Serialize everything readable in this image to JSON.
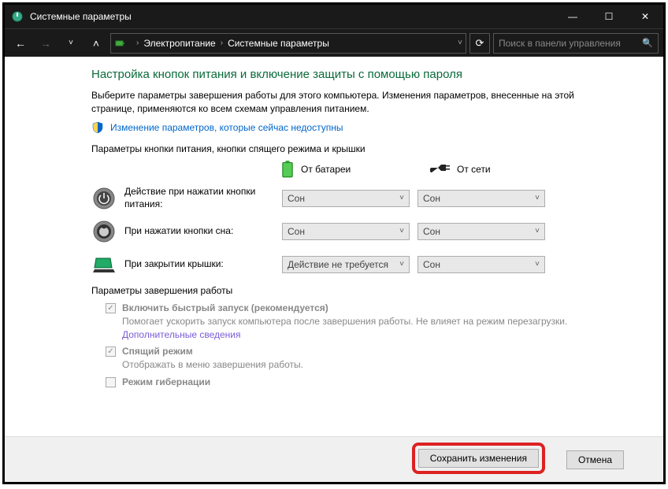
{
  "titlebar": {
    "title": "Системные параметры"
  },
  "winControls": {
    "min": "—",
    "max": "☐",
    "close": "✕"
  },
  "nav": {
    "back": "←",
    "fwd": "→",
    "up": "˄",
    "refresh": "⟳"
  },
  "breadcrumb": {
    "item1": "Электропитание",
    "item2": "Системные параметры"
  },
  "search": {
    "placeholder": "Поиск в панели управления"
  },
  "main": {
    "heading": "Настройка кнопок питания и включение защиты с помощью пароля",
    "desc": "Выберите параметры завершения работы для этого компьютера. Изменения параметров, внесенные на этой странице, применяются ко всем схемам управления питанием.",
    "linkUnavailable": "Изменение параметров, которые сейчас недоступны",
    "section1": "Параметры кнопки питания, кнопки спящего режима и крышки",
    "colBattery": "От батареи",
    "colAC": "От сети",
    "rowPower": "Действие при нажатии кнопки питания:",
    "rowSleep": "При нажатии кнопки сна:",
    "rowLid": "При закрытии крышки:",
    "valSleep": "Сон",
    "valNoAction": "Действие не требуется",
    "section2": "Параметры завершения работы",
    "chkFast": "Включить быстрый запуск (рекомендуется)",
    "descFast1": "Помогает ускорить запуск компьютера после завершения работы. Не влияет на режим перезагрузки. ",
    "descFastLink": "Дополнительные сведения",
    "chkSleep": "Спящий режим",
    "descSleep": "Отображать в меню завершения работы.",
    "chkHiber": "Режим гибернации"
  },
  "footer": {
    "save": "Сохранить изменения",
    "cancel": "Отмена"
  }
}
